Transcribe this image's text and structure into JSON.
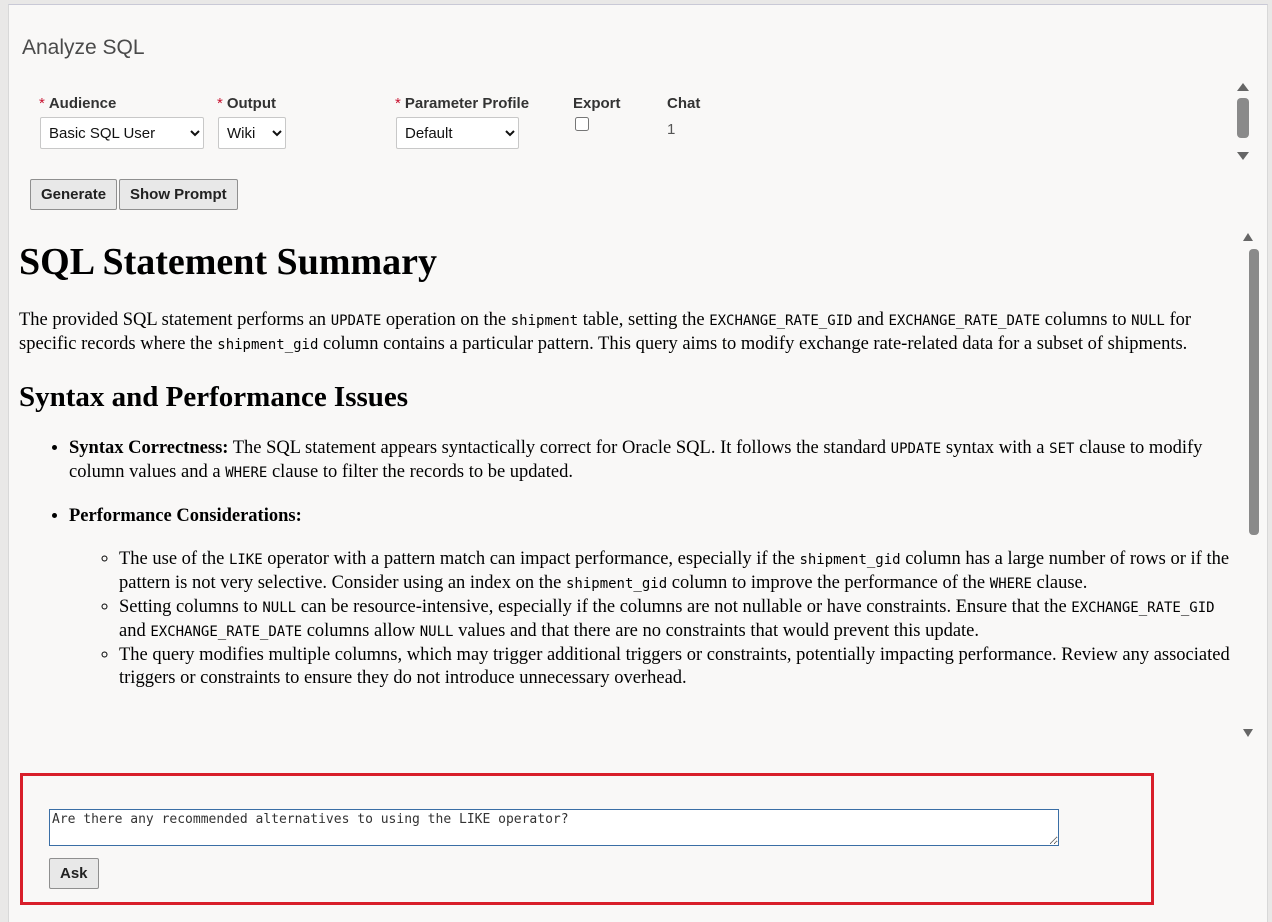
{
  "page": {
    "title": "Analyze SQL"
  },
  "form": {
    "required_mark": "*",
    "audience": {
      "label": "Audience",
      "value": "Basic SQL User"
    },
    "output": {
      "label": "Output",
      "value": "Wiki"
    },
    "parameter_profile": {
      "label": "Parameter Profile",
      "value": "Default"
    },
    "export": {
      "label": "Export",
      "checked": false
    },
    "chat": {
      "label": "Chat",
      "value": "1"
    }
  },
  "buttons": {
    "generate": "Generate",
    "show_prompt": "Show Prompt",
    "ask": "Ask"
  },
  "content": {
    "h1": "SQL Statement Summary",
    "summary": [
      {
        "t": "The provided SQL statement performs an "
      },
      {
        "c": "UPDATE"
      },
      {
        "t": " operation on the "
      },
      {
        "c": "shipment"
      },
      {
        "t": " table, setting the "
      },
      {
        "c": "EXCHANGE_RATE_GID"
      },
      {
        "t": " and "
      },
      {
        "c": "EXCHANGE_RATE_DATE"
      },
      {
        "t": " columns to "
      },
      {
        "c": "NULL"
      },
      {
        "t": " for specific records where the "
      },
      {
        "c": "shipment_gid"
      },
      {
        "t": " column contains a particular pattern. This query aims to modify exchange rate-related data for a subset of shipments."
      }
    ],
    "h2": "Syntax and Performance Issues",
    "syntax_item": {
      "bold": "Syntax Correctness:",
      "parts": [
        {
          "t": " The SQL statement appears syntactically correct for Oracle SQL. It follows the standard "
        },
        {
          "c": "UPDATE"
        },
        {
          "t": " syntax with a "
        },
        {
          "c": "SET"
        },
        {
          "t": " clause to modify column values and a "
        },
        {
          "c": "WHERE"
        },
        {
          "t": " clause to filter the records to be updated."
        }
      ]
    },
    "performance_item": {
      "bold": "Performance Considerations:",
      "subitems": [
        [
          {
            "t": "The use of the "
          },
          {
            "c": "LIKE"
          },
          {
            "t": " operator with a pattern match can impact performance, especially if the "
          },
          {
            "c": "shipment_gid"
          },
          {
            "t": " column has a large number of rows or if the pattern is not very selective. Consider using an index on the "
          },
          {
            "c": "shipment_gid"
          },
          {
            "t": " column to improve the performance of the "
          },
          {
            "c": "WHERE"
          },
          {
            "t": " clause."
          }
        ],
        [
          {
            "t": "Setting columns to "
          },
          {
            "c": "NULL"
          },
          {
            "t": " can be resource-intensive, especially if the columns are not nullable or have constraints. Ensure that the "
          },
          {
            "c": "EXCHANGE_RATE_GID"
          },
          {
            "t": " and "
          },
          {
            "c": "EXCHANGE_RATE_DATE"
          },
          {
            "t": " columns allow "
          },
          {
            "c": "NULL"
          },
          {
            "t": " values and that there are no constraints that would prevent this update."
          }
        ],
        [
          {
            "t": "The query modifies multiple columns, which may trigger additional triggers or constraints, potentially impacting performance. Review any associated triggers or constraints to ensure they do not introduce unnecessary overhead."
          }
        ]
      ]
    }
  },
  "chat_box": {
    "input_value": "Are there any recommended alternatives to using the LIKE operator?"
  }
}
